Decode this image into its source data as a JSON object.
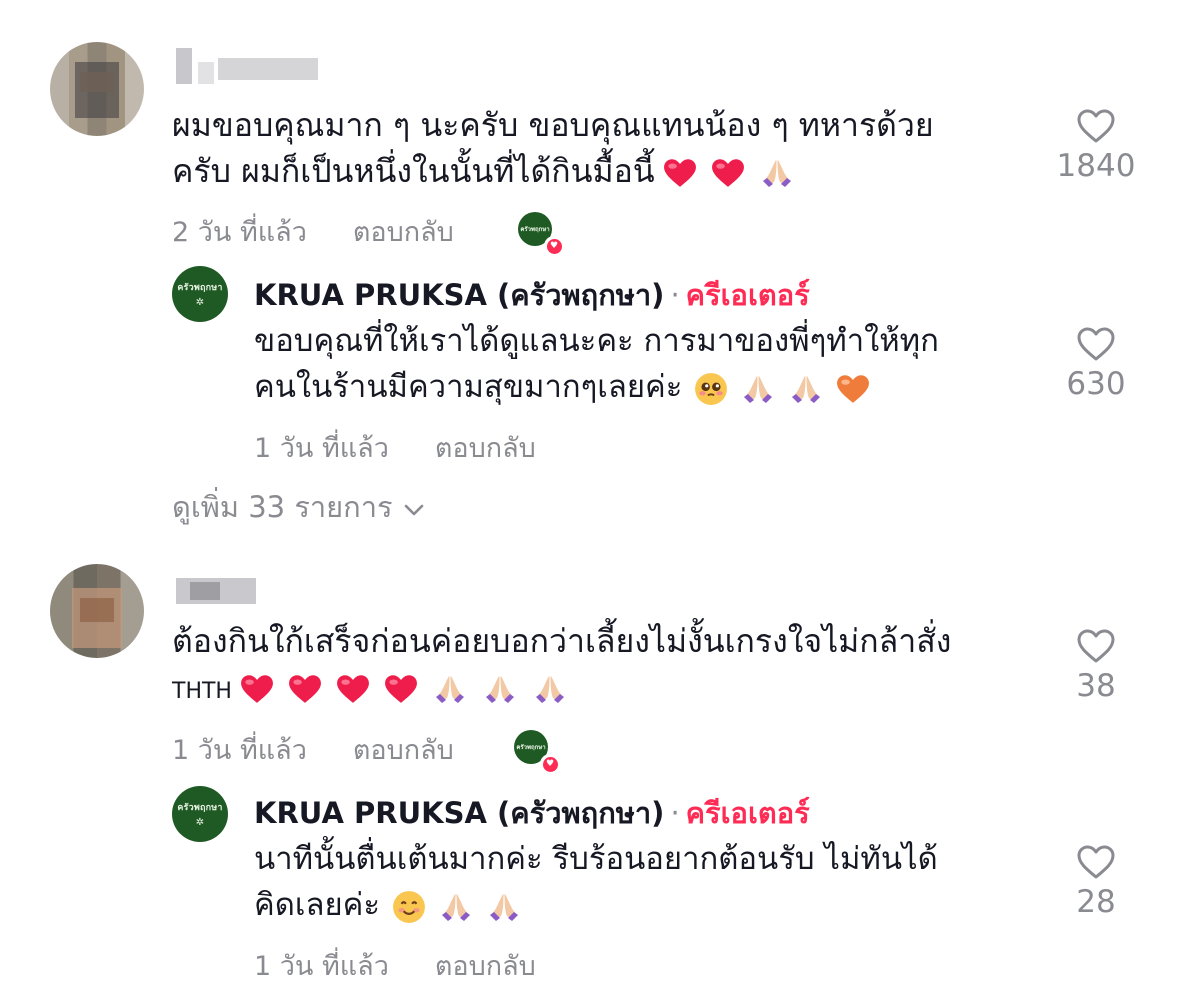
{
  "comments": [
    {
      "text_line1": "ผมขอบคุณมาก ๆ นะครับ ขอบคุณแทนน้อง ๆ ทหารด้วย",
      "text_line2": "ครับ ผมก็เป็นหนึ่งในนั้นที่ได้กินมื้อนี้",
      "time": "2 วัน ที่แล้ว",
      "reply_label": "ตอบกลับ",
      "likes": "1840",
      "reply": {
        "author": "KRUA PRUKSA (ครัวพฤกษา)",
        "separator": "·",
        "creator_label": "ครีเอเตอร์",
        "text_line1": "ขอบคุณที่ให้เราได้ดูแลนะคะ การมาของพี่ๆทำให้ทุก",
        "text_line2": "คนในร้านมีความสุขมากๆเลยค่ะ",
        "time": "1 วัน ที่แล้ว",
        "reply_label": "ตอบกลับ",
        "likes": "630"
      },
      "view_more": "ดูเพิ่ม 33 รายการ"
    },
    {
      "text_line1": "ต้องกินใก้เสร็จก่อนค่อยบอกว่าเลี้ยงไม่งั้นเกรงใจไม่กล้าสั่ง",
      "text_line2": "THTH",
      "time": "1 วัน ที่แล้ว",
      "reply_label": "ตอบกลับ",
      "likes": "38",
      "reply": {
        "author": "KRUA PRUKSA (ครัวพฤกษา)",
        "separator": "·",
        "creator_label": "ครีเอเตอร์",
        "text_line1": "นาทีนั้นตื่นเต้นมากค่ะ รีบร้อนอยากต้อนรับ ไม่ทันได้",
        "text_line2": "คิดเลยค่ะ",
        "time": "1 วัน ที่แล้ว",
        "reply_label": "ตอบกลับ",
        "likes": "28"
      }
    }
  ],
  "creator_logo_text": "ครัวพฤกษา",
  "colors": {
    "accent": "#fe2c55",
    "muted": "#8a8b91",
    "text": "#161823",
    "creator_green": "#1f5a24"
  },
  "icons": [
    "heart-outline-icon",
    "heart-emoji",
    "folded-hands-emoji",
    "smiling-face-emoji",
    "orange-heart-emoji",
    "chevron-down-icon",
    "liked-by-creator-badge"
  ]
}
